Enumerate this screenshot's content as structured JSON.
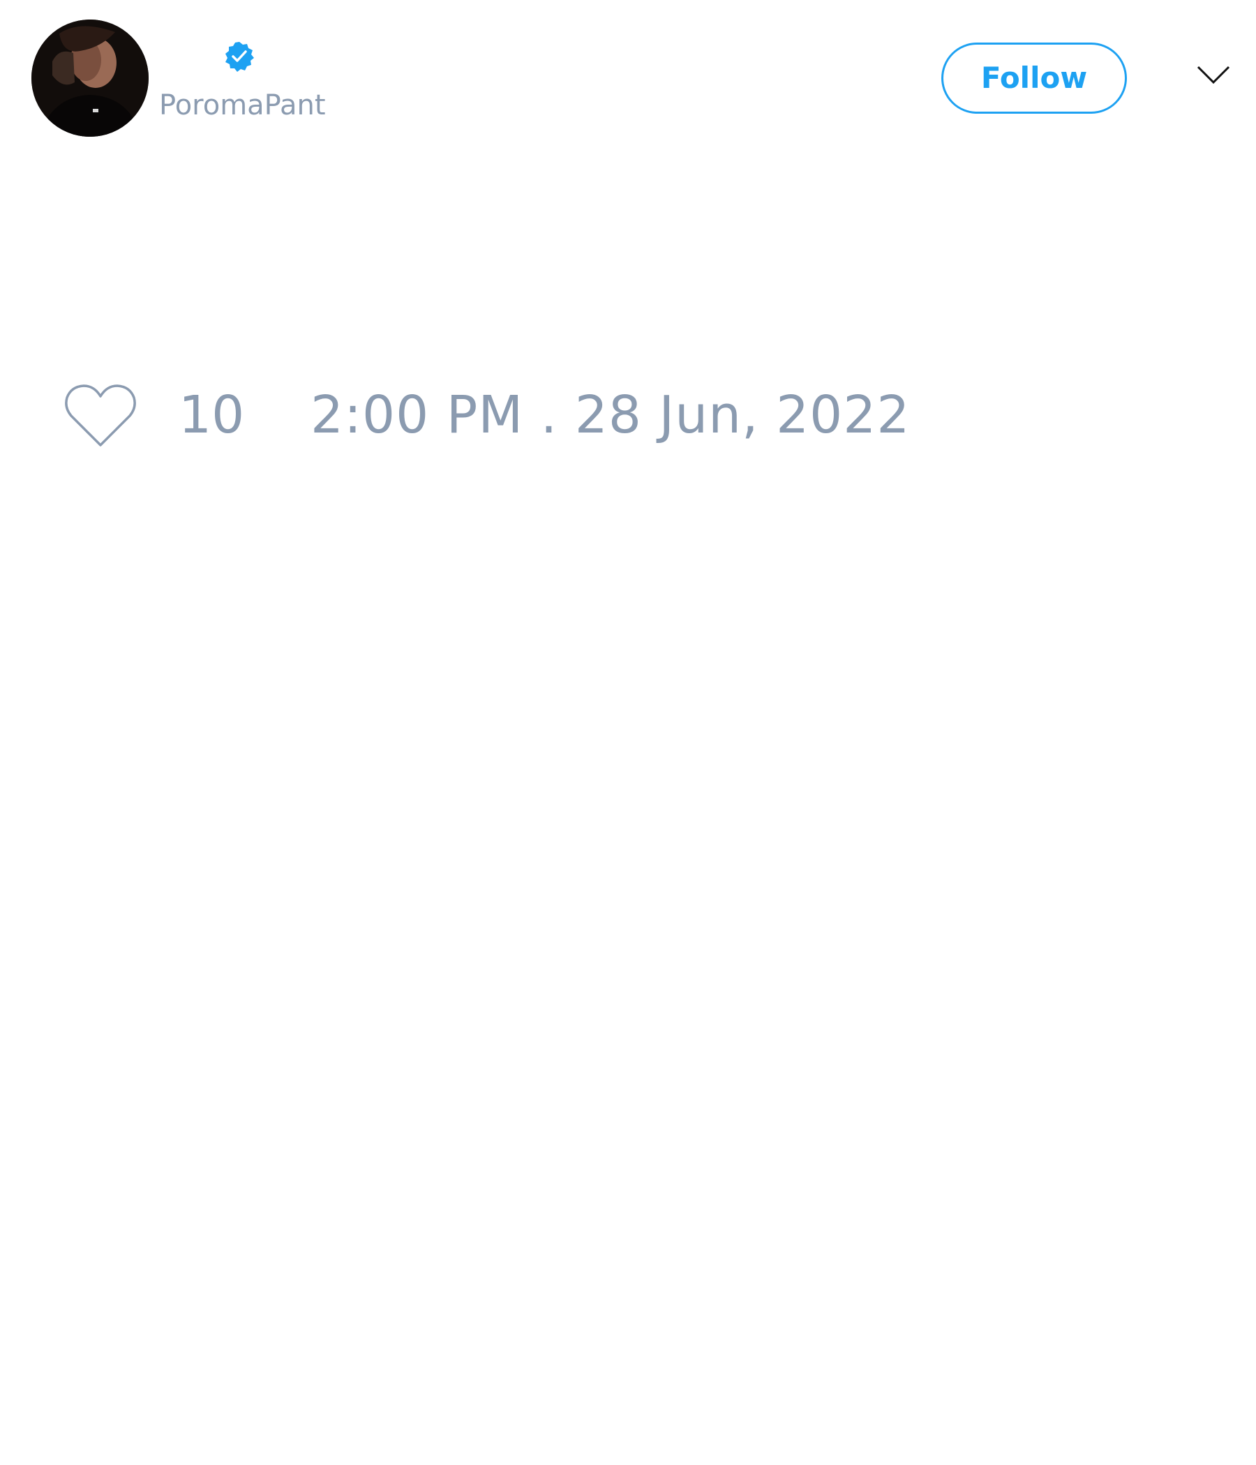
{
  "tweet": {
    "author": {
      "handle": "PoromaPant",
      "verified": true,
      "avatar_icon": "profile-photo"
    },
    "follow_label": "Follow",
    "menu_icon": "chevron-down-icon",
    "likes": {
      "icon": "heart-outline-icon",
      "count": "10"
    },
    "timestamp": "2:00 PM . 28 Jun, 2022"
  },
  "colors": {
    "accent": "#1da1f2",
    "muted_text": "#8b9bb0",
    "background": "#ffffff"
  }
}
